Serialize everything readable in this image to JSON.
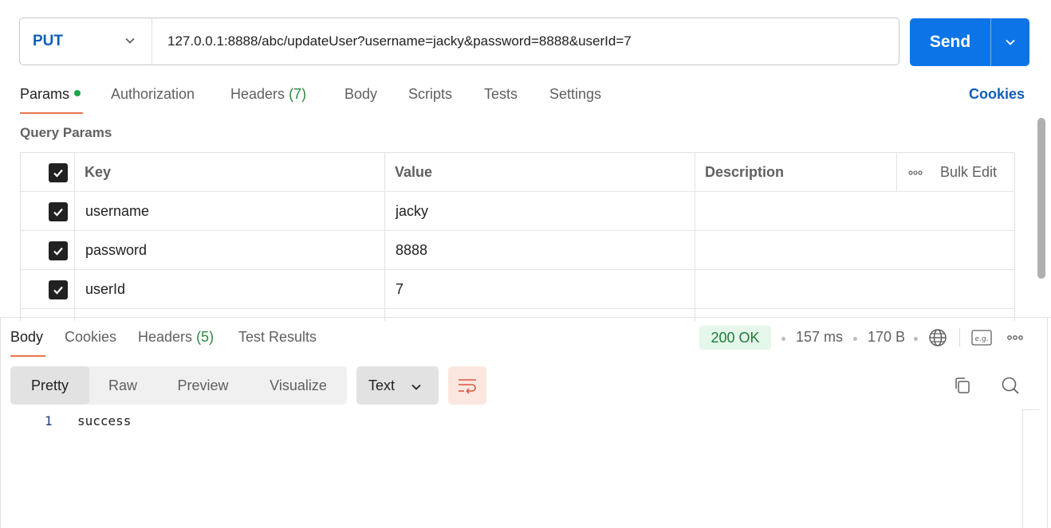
{
  "request": {
    "method": "PUT",
    "url": "127.0.0.1:8888/abc/updateUser?username=jacky&password=8888&userId=7",
    "send_label": "Send"
  },
  "request_tabs": {
    "params": "Params",
    "authorization": "Authorization",
    "headers_label": "Headers",
    "headers_count": "(7)",
    "body": "Body",
    "scripts": "Scripts",
    "tests": "Tests",
    "settings": "Settings",
    "cookies": "Cookies"
  },
  "query_params": {
    "title": "Query Params",
    "columns": {
      "key": "Key",
      "value": "Value",
      "description": "Description",
      "bulk_edit": "Bulk Edit"
    },
    "rows": [
      {
        "key": "username",
        "value": "jacky",
        "description": "",
        "checked": true
      },
      {
        "key": "password",
        "value": "8888",
        "description": "",
        "checked": true
      },
      {
        "key": "userId",
        "value": "7",
        "description": "",
        "checked": true
      }
    ]
  },
  "response": {
    "tabs": {
      "body": "Body",
      "cookies": "Cookies",
      "headers_label": "Headers",
      "headers_count": "(5)",
      "test_results": "Test Results"
    },
    "status": "200 OK",
    "time": "157 ms",
    "size": "170 B",
    "view_modes": [
      "Pretty",
      "Raw",
      "Preview",
      "Visualize"
    ],
    "active_view_mode": "Pretty",
    "format": "Text",
    "body_lines": [
      {
        "line": "1",
        "text": "success"
      }
    ]
  },
  "colors": {
    "accent_blue": "#0c74e6",
    "tab_underline": "#e8754c",
    "status_ok_bg": "#e5f6ea",
    "status_ok_text": "#1f7a3a"
  }
}
